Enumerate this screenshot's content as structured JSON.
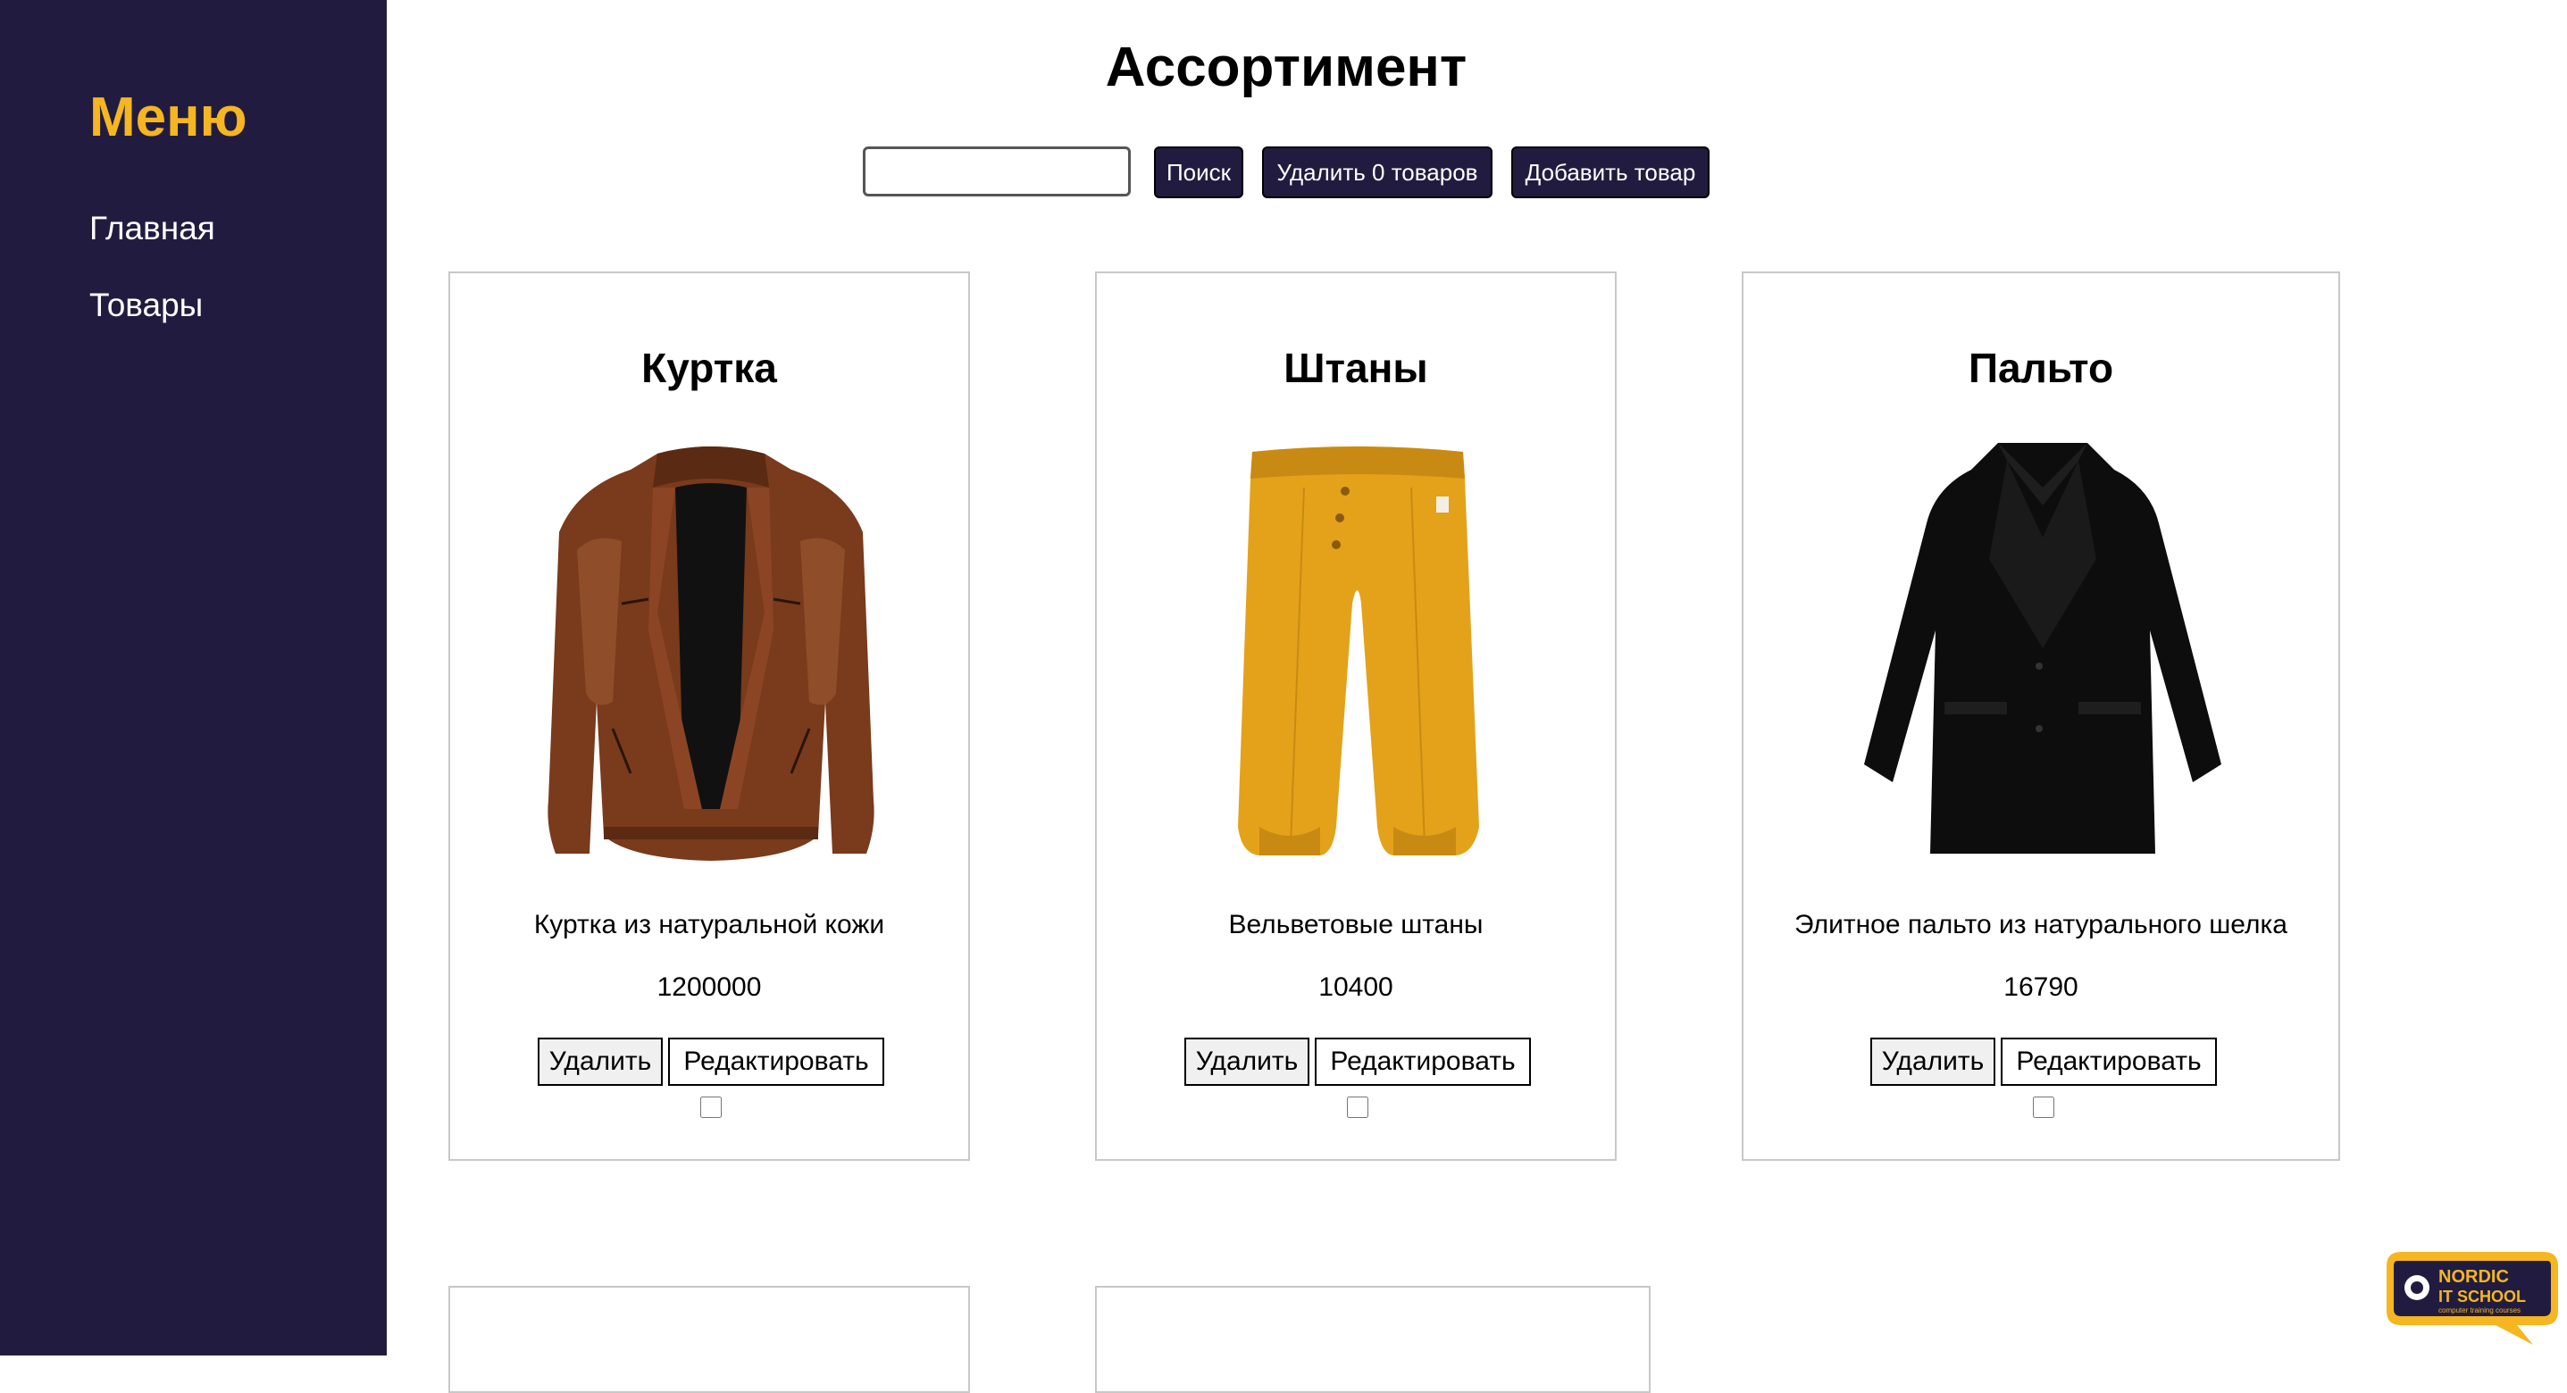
{
  "sidebar": {
    "title": "Меню",
    "links": [
      "Главная",
      "Товары"
    ]
  },
  "page": {
    "title": "Ассортимент"
  },
  "toolbar": {
    "search_value": "",
    "search_label": "Поиск",
    "delete_selected_label": "Удалить 0 товаров",
    "add_label": "Добавить товар"
  },
  "products": [
    {
      "title": "Куртка",
      "image_icon": "leather-jacket-image",
      "description": "Куртка из натуральной кожи",
      "price": "1200000",
      "delete_label": "Удалить",
      "edit_label": "Редактировать",
      "selected": false
    },
    {
      "title": "Штаны",
      "image_icon": "corduroy-pants-image",
      "description": "Вельветовые штаны",
      "price": "10400",
      "delete_label": "Удалить",
      "edit_label": "Редактировать",
      "selected": false
    },
    {
      "title": "Пальто",
      "image_icon": "black-coat-image",
      "description": "Элитное пальто из натурального шелка",
      "price": "16790",
      "delete_label": "Удалить",
      "edit_label": "Редактировать",
      "selected": false
    }
  ],
  "logo": {
    "line1": "NORDIC",
    "line2": "IT SCHOOL",
    "tagline": "computer training courses"
  },
  "colors": {
    "sidebar_bg": "#211c3f",
    "menu_title": "#f5b621",
    "button_bg": "#211c3f",
    "card_border": "#c8c8c8",
    "logo_bg": "#f5b621"
  }
}
